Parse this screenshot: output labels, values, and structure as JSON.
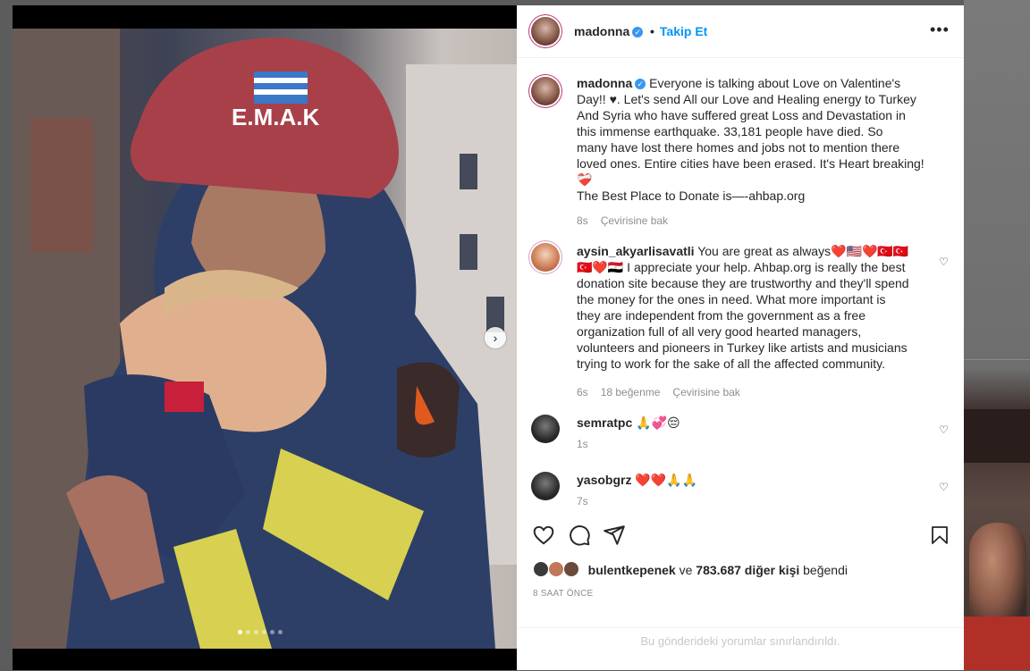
{
  "post": {
    "author": "madonna",
    "follow_separator": "•",
    "follow_label": "Takip Et",
    "more_icon": "ellipsis-icon",
    "caption": {
      "username": "madonna",
      "lines": [
        "Everyone is talking about Love  on Valentine's",
        "Day!! ♥. Let's send All our Love and Healing  energy to Turkey",
        "And Syria who have suffered great Loss and Devastation in",
        "this immense earthquake.  33,181 people have died.  So",
        "many  have lost there homes and jobs not to mention there",
        "loved ones. Entire cities have been erased. It's Heart breaking!",
        "❤️‍🩹",
        "The Best Place to Donate is—-ahbap.org"
      ],
      "time": "8s",
      "translate": "Çevirisine bak"
    },
    "comments": [
      {
        "username": "aysin_akyarlisavatli",
        "lines": [
          "You are great as always❤️🇺🇸❤️🇹🇷🇹🇷",
          "🇹🇷❤️🇪🇬 I appreciate your help. Ahbap.org is really the best",
          "donation site because they are trustworthy and they'll spend",
          "the money for the ones in need. What more important is",
          "they are independent from the government as a free",
          "organization full of all very good hearted managers,",
          "volunteers and pioneers in Turkey like artists and musicians",
          "trying to work for the sake of all the affected community."
        ],
        "time": "6s",
        "likes": "18 beğenme",
        "translate": "Çevirisine bak"
      },
      {
        "username": "semratpc",
        "text": "🙏💞😔",
        "time": "1s"
      },
      {
        "username": "yasobgrz",
        "text": "❤️❤️🙏🙏",
        "time": "7s"
      }
    ],
    "likes": {
      "first_liker": "bulentkepenek",
      "connector": "ve",
      "others_count": "783.687 diğer kişi",
      "suffix": "beğendi"
    },
    "posted_ago": "8 SAAT ÖNCE",
    "comments_limited": "Bu gönderideki yorumlar sınırlandırıldı.",
    "carousel": {
      "total_slides": 6,
      "active_slide": 1,
      "next_icon": "chevron-right-icon"
    },
    "photo": {
      "helmet_text": "E.M.A.K"
    }
  },
  "colors": {
    "link": "#0095f6",
    "text": "#262626",
    "secondary": "#8e8e8e",
    "verified": "#3897f0"
  }
}
